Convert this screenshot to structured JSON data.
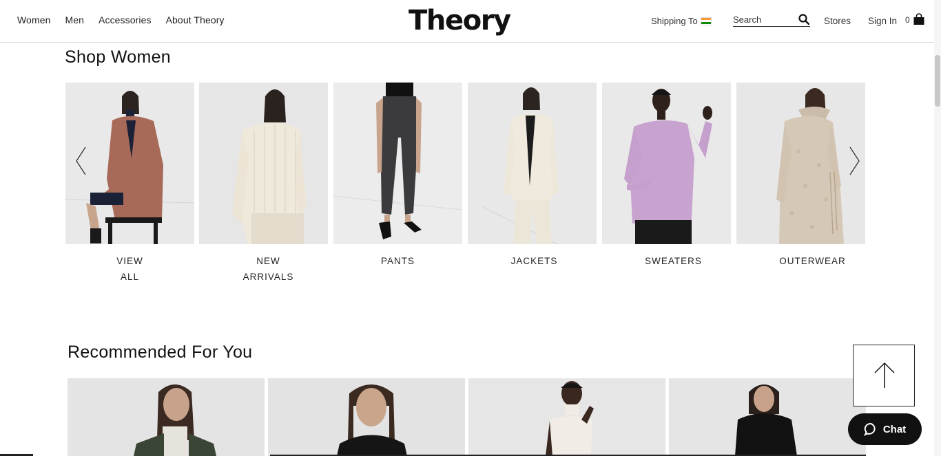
{
  "header": {
    "nav": [
      "Women",
      "Men",
      "Accessories",
      "About Theory"
    ],
    "logo": "Theory",
    "shipping_label": "Shipping To",
    "search_placeholder": "Search",
    "stores": "Stores",
    "sign_in": "Sign In",
    "cart_count": "0"
  },
  "shop_women": {
    "title": "Shop Women",
    "categories": [
      {
        "line1": "VIEW",
        "line2": "ALL"
      },
      {
        "line1": "NEW",
        "line2": "ARRIVALS"
      },
      {
        "line1": "PANTS",
        "line2": ""
      },
      {
        "line1": "JACKETS",
        "line2": ""
      },
      {
        "line1": "SWEATERS",
        "line2": ""
      },
      {
        "line1": "OUTERWEAR",
        "line2": ""
      }
    ]
  },
  "recommended": {
    "title": "Recommended For You"
  },
  "chat": {
    "label": "Chat"
  },
  "colors": {
    "text": "#1a1a1a",
    "chat_bg": "#111111",
    "coat_brown": "#a86a58",
    "sweater_lilac": "#c9a3cf",
    "flag_saffron": "#ff9933",
    "flag_green": "#138808"
  }
}
